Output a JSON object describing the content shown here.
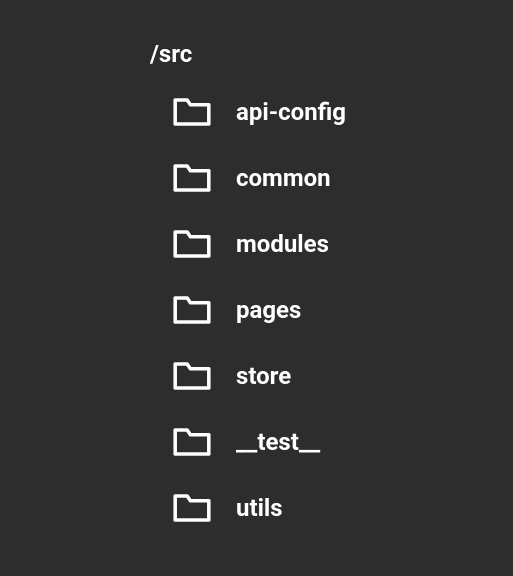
{
  "root": {
    "label": "/src"
  },
  "folders": [
    {
      "label": "api-config"
    },
    {
      "label": "common"
    },
    {
      "label": "modules"
    },
    {
      "label": "pages"
    },
    {
      "label": "store"
    },
    {
      "label": "__test__"
    },
    {
      "label": "utils"
    }
  ]
}
